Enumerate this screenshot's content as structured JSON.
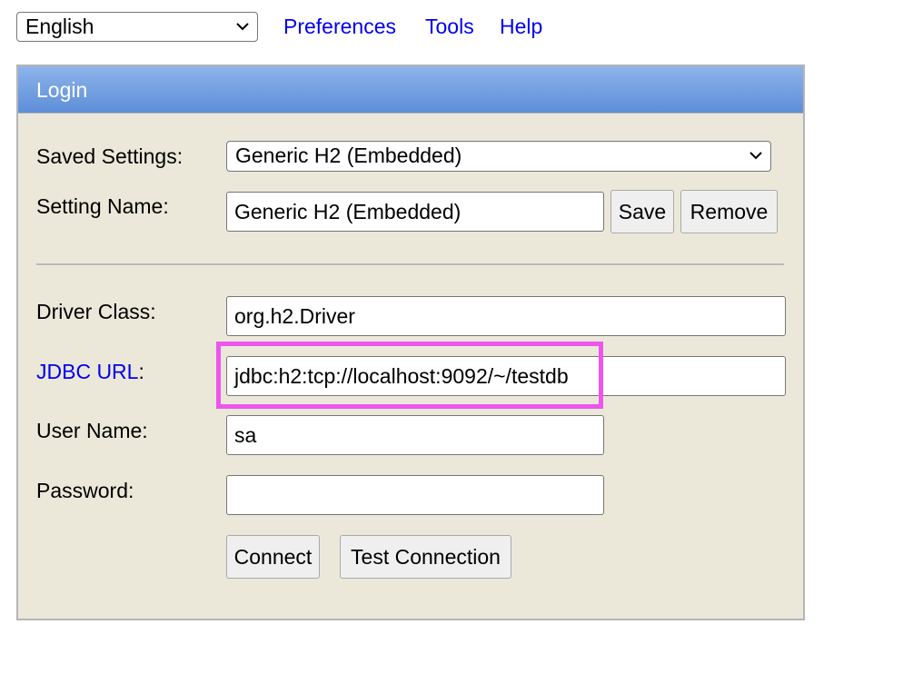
{
  "topbar": {
    "language": {
      "selected": "English"
    },
    "links": [
      "Preferences",
      "Tools",
      "Help"
    ]
  },
  "login": {
    "title": "Login",
    "saved_settings": {
      "label": "Saved Settings:",
      "selected": "Generic H2 (Embedded)"
    },
    "setting_name": {
      "label": "Setting Name:",
      "value": "Generic H2 (Embedded)"
    },
    "save_label": "Save",
    "remove_label": "Remove",
    "driver_class": {
      "label": "Driver Class:",
      "value": "org.h2.Driver"
    },
    "jdbc_url": {
      "label_link": "JDBC URL",
      "label_suffix": ":",
      "value": "jdbc:h2:tcp://localhost:9092/~/testdb"
    },
    "user_name": {
      "label": "User Name:",
      "value": "sa"
    },
    "password": {
      "label": "Password:",
      "value": ""
    },
    "connect_label": "Connect",
    "test_connection_label": "Test Connection"
  },
  "colors": {
    "header_gradient_top": "#8db4ea",
    "header_gradient_bottom": "#5d8ed8",
    "panel_background": "#ebe8da",
    "link": "#0000ee",
    "highlight": "#ee55ee"
  },
  "icons": {
    "dropdown": "chevron-down-icon"
  }
}
